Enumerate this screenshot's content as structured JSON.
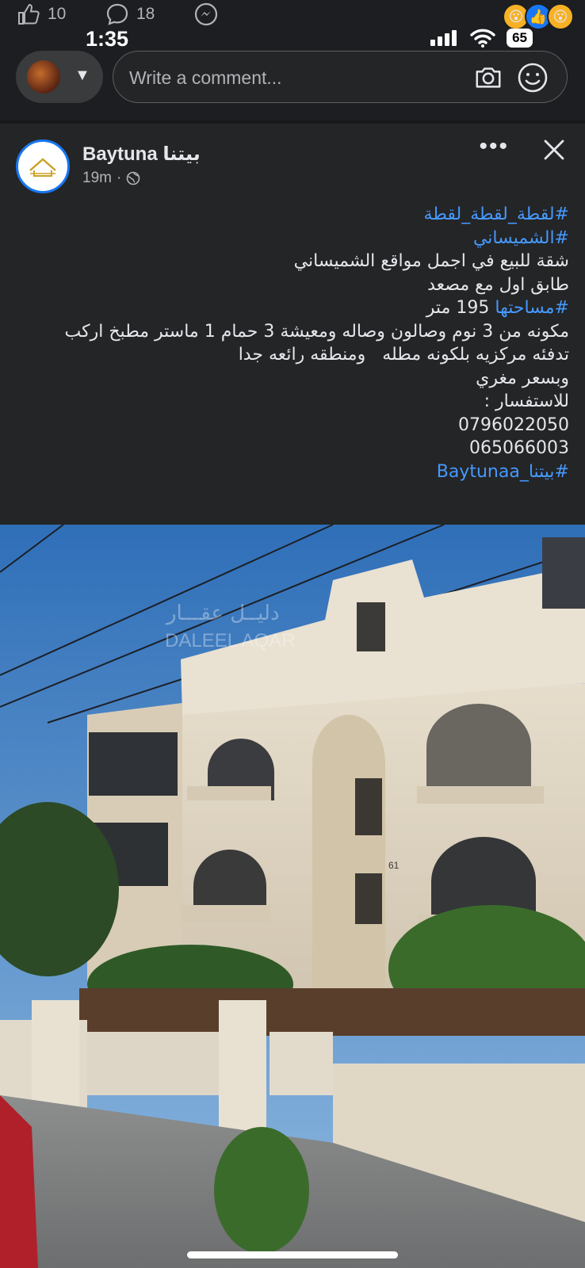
{
  "reactions_bar": {
    "like_count": "10",
    "comment_count": "18",
    "icons": [
      "like-icon",
      "comment-icon",
      "messenger-icon"
    ],
    "reaction_icons": [
      "wow-icon",
      "like-reaction-icon",
      "wow-icon"
    ]
  },
  "status_bar": {
    "time": "1:35",
    "battery": "65"
  },
  "comment_composer": {
    "placeholder": "Write a comment...",
    "icons": [
      "camera-icon",
      "emoji-icon"
    ]
  },
  "post": {
    "page_name": "Baytuna بيتنا",
    "time_ago": "19m",
    "audience_icon": "globe-icon",
    "lines": [
      {
        "type": "hashtag",
        "text": "#لقطة_لقطة_لقطة"
      },
      {
        "type": "hashtag",
        "text": "#الشميساني"
      },
      {
        "type": "text",
        "text": "شقة للبيع في اجمل مواقع الشميساني"
      },
      {
        "type": "text",
        "text": "طابق اول مع مصعد"
      },
      {
        "type": "mixed",
        "hashtag": "#مساحتها",
        "text": " 195 متر"
      },
      {
        "type": "text",
        "text": "مكونه من 3 نوم وصالون وصاله ومعيشة 3 حمام 1 ماستر مطبخ اركب"
      },
      {
        "type": "text",
        "text": "تدفئه مركزيه بلكونه مطله   ومنطقه رائعه جدا"
      },
      {
        "type": "text",
        "text": "وبسعر مغري"
      },
      {
        "type": "text",
        "text": "للاستفسار :"
      },
      {
        "type": "text",
        "text": "0796022050"
      },
      {
        "type": "text",
        "text": "065066003"
      },
      {
        "type": "hashtag",
        "text": "#بيتنا_Baytunaa"
      }
    ],
    "photo": {
      "watermark_ar": "دليــل عقـــار",
      "watermark_en": "DALEEL AQAR",
      "house_number": "61"
    }
  }
}
